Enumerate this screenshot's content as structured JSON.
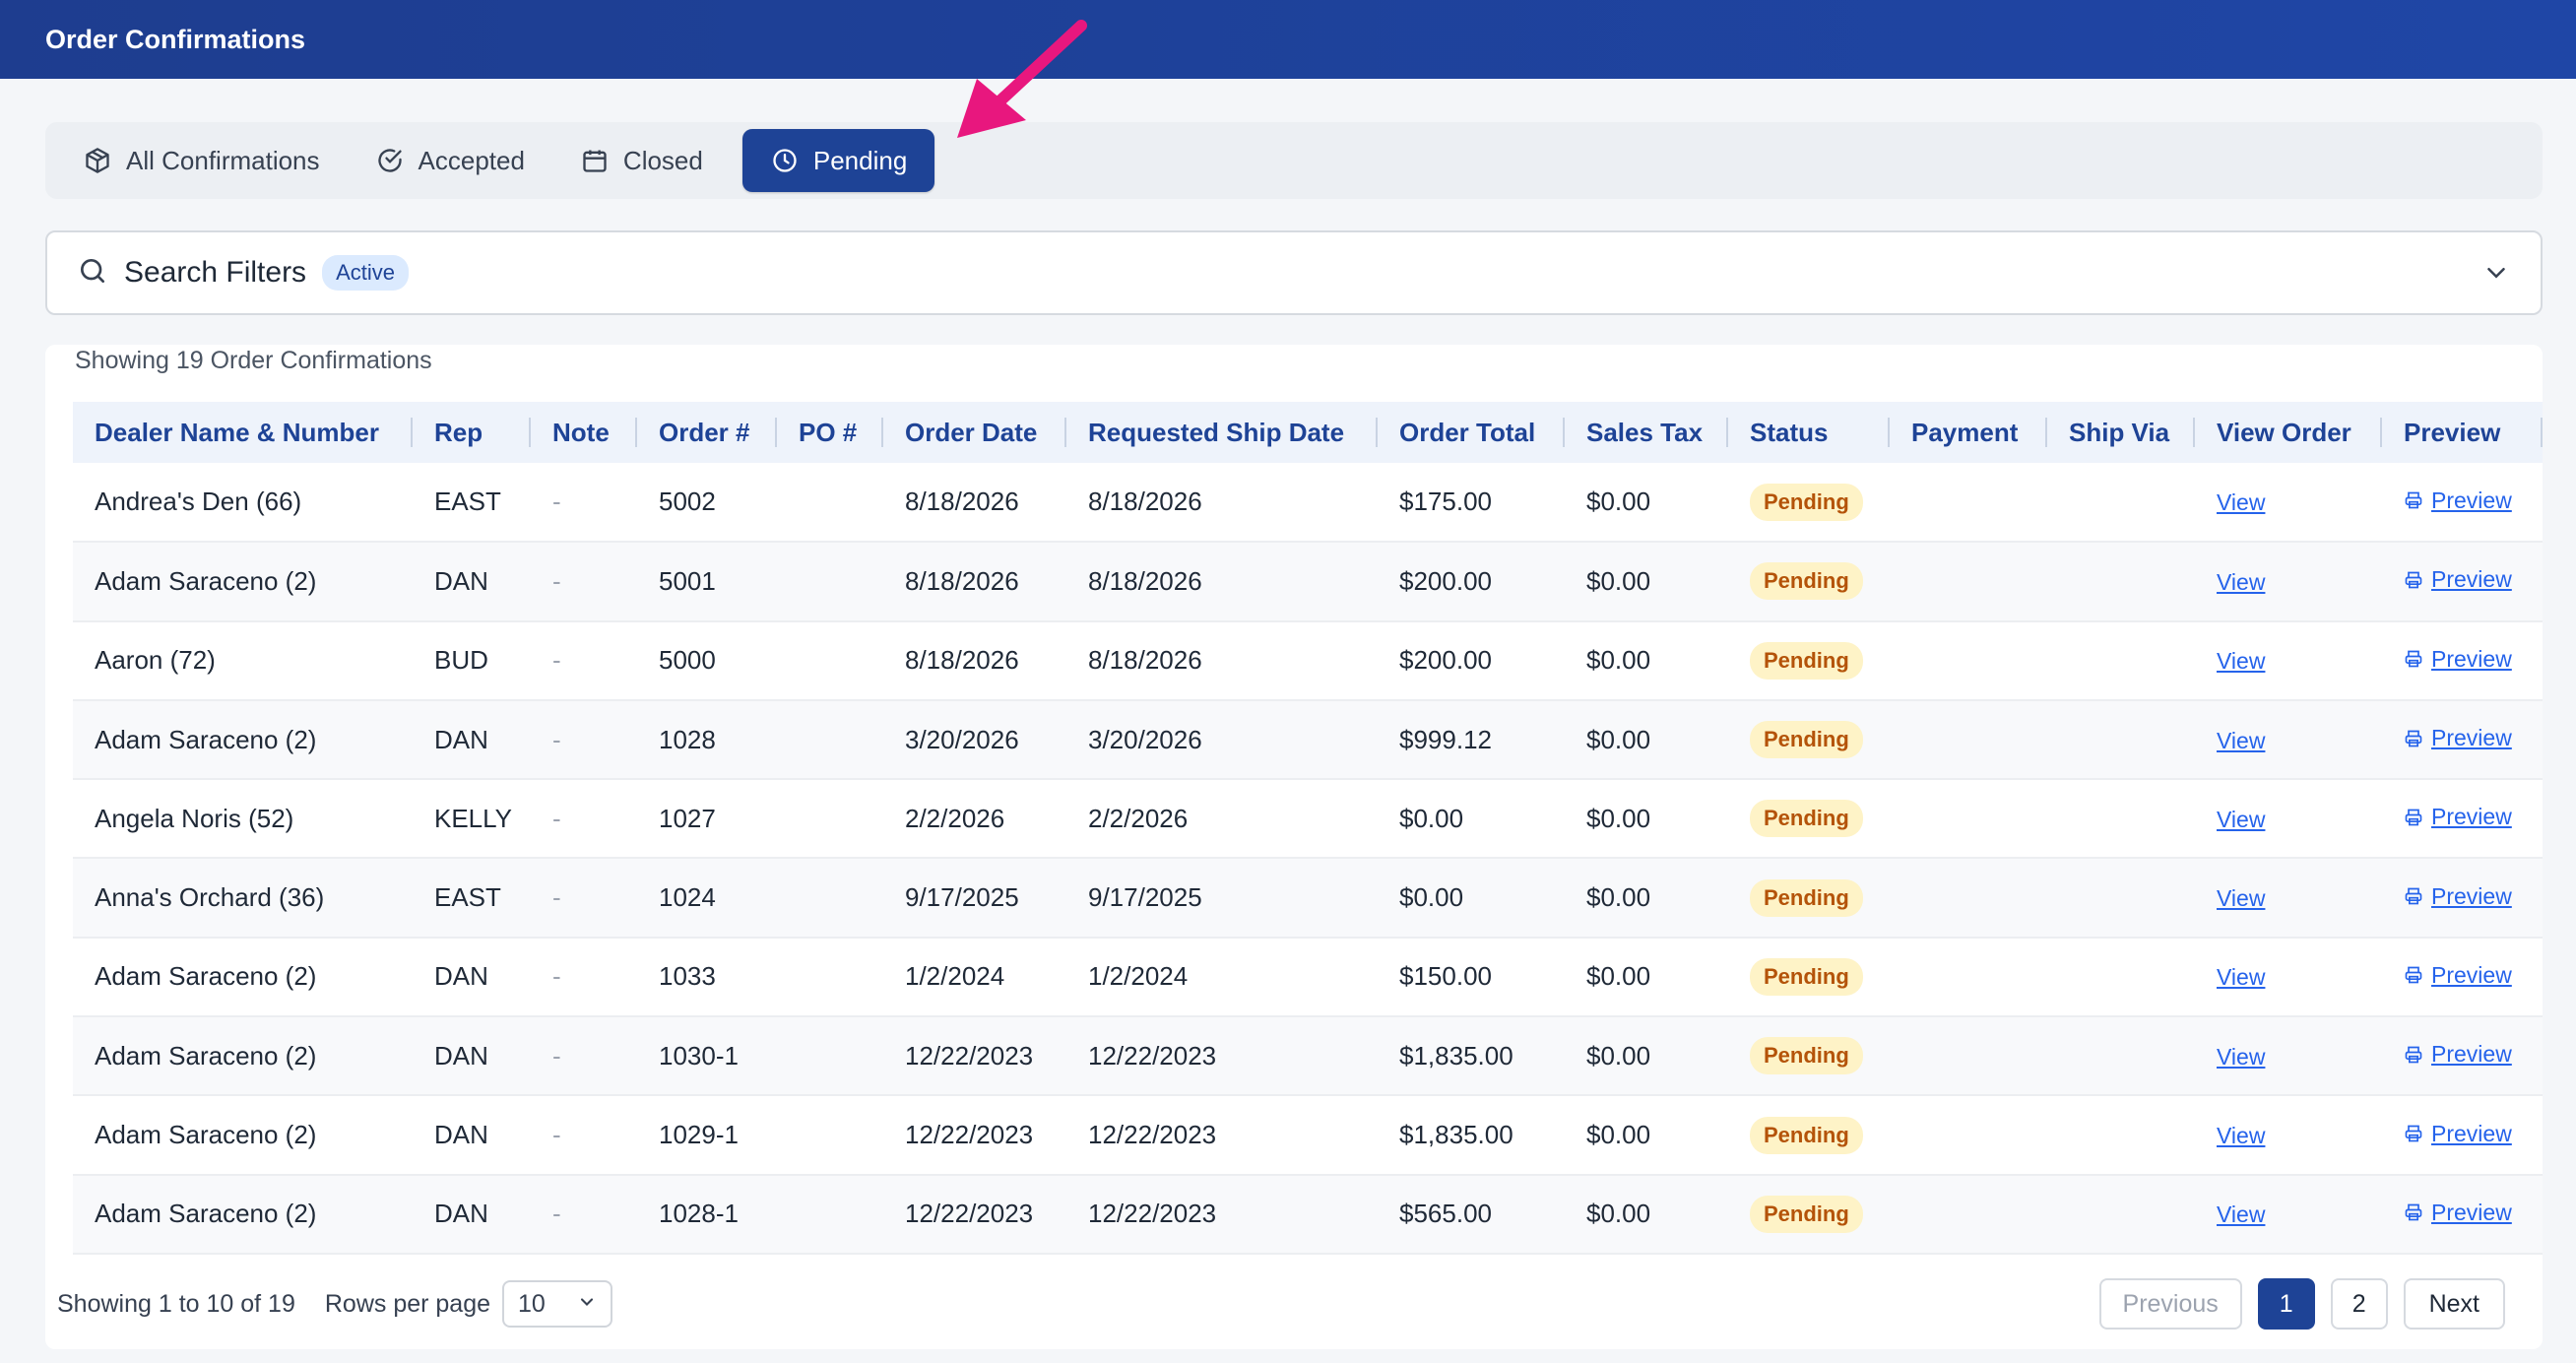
{
  "header": {
    "title": "Order Confirmations"
  },
  "tabs": [
    {
      "label": "All Confirmations",
      "icon": "box-icon",
      "active": false
    },
    {
      "label": "Accepted",
      "icon": "check-circle-icon",
      "active": false
    },
    {
      "label": "Closed",
      "icon": "calendar-icon",
      "active": false
    },
    {
      "label": "Pending",
      "icon": "clock-icon",
      "active": true
    }
  ],
  "filters": {
    "title": "Search Filters",
    "badge": "Active"
  },
  "table": {
    "showing": "Showing 19 Order Confirmations",
    "columns": [
      "Dealer Name & Number",
      "Rep",
      "Note",
      "Order #",
      "PO #",
      "Order Date",
      "Requested Ship Date",
      "Order Total",
      "Sales Tax",
      "Status",
      "Payment",
      "Ship Via",
      "View Order",
      "Preview"
    ],
    "rows": [
      {
        "dealer": "Andrea's Den (66)",
        "rep": "EAST",
        "note": "-",
        "order": "5002",
        "po": "",
        "order_date": "8/18/2026",
        "ship_date": "8/18/2026",
        "total": "$175.00",
        "tax": "$0.00",
        "status": "Pending",
        "payment": "",
        "ship_via": "",
        "view": "View",
        "preview": "Preview"
      },
      {
        "dealer": "Adam Saraceno (2)",
        "rep": "DAN",
        "note": "-",
        "order": "5001",
        "po": "",
        "order_date": "8/18/2026",
        "ship_date": "8/18/2026",
        "total": "$200.00",
        "tax": "$0.00",
        "status": "Pending",
        "payment": "",
        "ship_via": "",
        "view": "View",
        "preview": "Preview"
      },
      {
        "dealer": "Aaron (72)",
        "rep": "BUD",
        "note": "-",
        "order": "5000",
        "po": "",
        "order_date": "8/18/2026",
        "ship_date": "8/18/2026",
        "total": "$200.00",
        "tax": "$0.00",
        "status": "Pending",
        "payment": "",
        "ship_via": "",
        "view": "View",
        "preview": "Preview"
      },
      {
        "dealer": "Adam Saraceno (2)",
        "rep": "DAN",
        "note": "-",
        "order": "1028",
        "po": "",
        "order_date": "3/20/2026",
        "ship_date": "3/20/2026",
        "total": "$999.12",
        "tax": "$0.00",
        "status": "Pending",
        "payment": "",
        "ship_via": "",
        "view": "View",
        "preview": "Preview"
      },
      {
        "dealer": "Angela Noris (52)",
        "rep": "KELLY",
        "note": "-",
        "order": "1027",
        "po": "",
        "order_date": "2/2/2026",
        "ship_date": "2/2/2026",
        "total": "$0.00",
        "tax": "$0.00",
        "status": "Pending",
        "payment": "",
        "ship_via": "",
        "view": "View",
        "preview": "Preview"
      },
      {
        "dealer": "Anna's Orchard (36)",
        "rep": "EAST",
        "note": "-",
        "order": "1024",
        "po": "",
        "order_date": "9/17/2025",
        "ship_date": "9/17/2025",
        "total": "$0.00",
        "tax": "$0.00",
        "status": "Pending",
        "payment": "",
        "ship_via": "",
        "view": "View",
        "preview": "Preview"
      },
      {
        "dealer": "Adam Saraceno (2)",
        "rep": "DAN",
        "note": "-",
        "order": "1033",
        "po": "",
        "order_date": "1/2/2024",
        "ship_date": "1/2/2024",
        "total": "$150.00",
        "tax": "$0.00",
        "status": "Pending",
        "payment": "",
        "ship_via": "",
        "view": "View",
        "preview": "Preview"
      },
      {
        "dealer": "Adam Saraceno (2)",
        "rep": "DAN",
        "note": "-",
        "order": "1030-1",
        "po": "",
        "order_date": "12/22/2023",
        "ship_date": "12/22/2023",
        "total": "$1,835.00",
        "tax": "$0.00",
        "status": "Pending",
        "payment": "",
        "ship_via": "",
        "view": "View",
        "preview": "Preview"
      },
      {
        "dealer": "Adam Saraceno (2)",
        "rep": "DAN",
        "note": "-",
        "order": "1029-1",
        "po": "",
        "order_date": "12/22/2023",
        "ship_date": "12/22/2023",
        "total": "$1,835.00",
        "tax": "$0.00",
        "status": "Pending",
        "payment": "",
        "ship_via": "",
        "view": "View",
        "preview": "Preview"
      },
      {
        "dealer": "Adam Saraceno (2)",
        "rep": "DAN",
        "note": "-",
        "order": "1028-1",
        "po": "",
        "order_date": "12/22/2023",
        "ship_date": "12/22/2023",
        "total": "$565.00",
        "tax": "$0.00",
        "status": "Pending",
        "payment": "",
        "ship_via": "",
        "view": "View",
        "preview": "Preview"
      }
    ]
  },
  "footer": {
    "showing_range": "Showing 1 to 10 of 19",
    "rows_per_page_label": "Rows per page",
    "rows_per_page_value": "10",
    "previous": "Previous",
    "pages": [
      "1",
      "2"
    ],
    "current_page": "1",
    "next": "Next"
  },
  "colors": {
    "brand": "#1e4396",
    "pending_bg": "#fef3c7",
    "pending_text": "#b45309",
    "annotation_arrow": "#e8177e",
    "link": "#2563eb"
  }
}
